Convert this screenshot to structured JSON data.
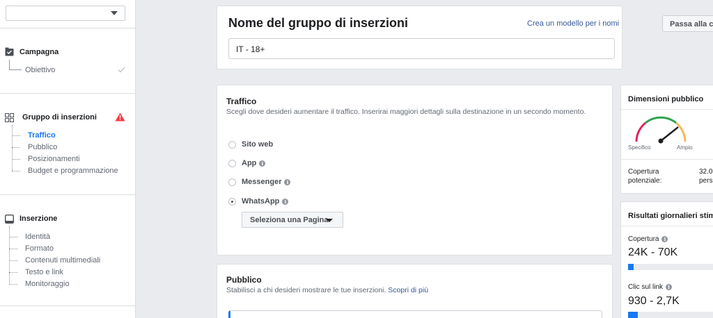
{
  "sidebar": {
    "campaign": {
      "title": "Campagna",
      "items": [
        {
          "label": "Obiettivo"
        }
      ]
    },
    "adset": {
      "title": "Gruppo di inserzioni",
      "items": [
        {
          "label": "Traffico"
        },
        {
          "label": "Pubblico"
        },
        {
          "label": "Posizionamenti"
        },
        {
          "label": "Budget e programmazione"
        }
      ]
    },
    "ad": {
      "title": "Inserzione",
      "items": [
        {
          "label": "Identità"
        },
        {
          "label": "Formato"
        },
        {
          "label": "Contenuti multimediali"
        },
        {
          "label": "Testo e link"
        },
        {
          "label": "Monitoraggio"
        }
      ]
    }
  },
  "header": {
    "title": "Nome del gruppo di inserzioni",
    "template_link": "Crea un modello per i nomi",
    "name_value": "IT - 18+",
    "next_button": "Passa alla creazione dell'inserzione"
  },
  "traffic": {
    "title": "Traffico",
    "description": "Scegli dove desideri aumentare il traffico. Inserirai maggiori dettagli sulla destinazione in un secondo momento.",
    "options": [
      {
        "label": "Sito web",
        "checked": false,
        "info": false
      },
      {
        "label": "App",
        "checked": false,
        "info": true
      },
      {
        "label": "Messenger",
        "checked": false,
        "info": true
      },
      {
        "label": "WhatsApp",
        "checked": true,
        "info": true
      }
    ],
    "page_select": "Seleziona una Pagina"
  },
  "audience": {
    "title": "Pubblico",
    "description": "Stabilisci a chi desideri mostrare le tue inserzioni.",
    "learn_more": "Scopri di più"
  },
  "audience_size": {
    "title": "Dimensioni pubblico",
    "gauge_left": "Specifico",
    "gauge_right": "Ampio",
    "coverage_label": "Copertura potenziale:",
    "coverage_value": "32.0",
    "coverage_unit": "pers"
  },
  "daily_results": {
    "title": "Risultati giornalieri stimati",
    "reach": {
      "label": "Copertura",
      "value": "24K - 70K",
      "fraction": 0.06
    },
    "clicks": {
      "label": "Clic sul link",
      "value": "930 - 2,7K",
      "fraction": 0.1
    }
  },
  "colors": {
    "accent": "#1877f2",
    "link": "#365899",
    "warning": "#fa383e",
    "gauge_red": "#e0245e",
    "gauge_green": "#2ea44f",
    "gauge_amber": "#f7b955"
  }
}
